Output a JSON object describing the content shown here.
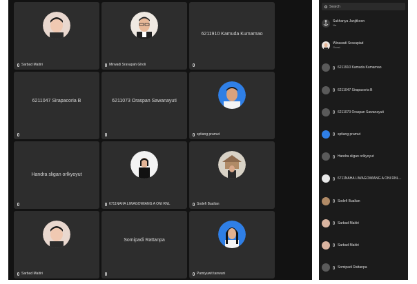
{
  "tiles": [
    {
      "caption": "Sarbad Maitiri"
    },
    {
      "caption": "Mirwadi Sravapah Gholi"
    },
    {
      "center": "6211910 Kamuda Kumarnao",
      "caption": ""
    },
    {
      "center": "6211047 Sirapacoria B",
      "caption": ""
    },
    {
      "center": "6211073 Oraspan Sawanayuti",
      "caption": ""
    },
    {
      "caption": "sptiang pramut"
    },
    {
      "center": "Handra sligan orlkyoyut",
      "caption": ""
    },
    {
      "caption": "6711NAHA LIWAGOWIANG A ONI RNL"
    },
    {
      "caption": "Sodefi Bualtan"
    },
    {
      "caption": "Sarbad Maitiri"
    },
    {
      "center": "Somipadi Rattanpa",
      "caption": ""
    },
    {
      "caption": "Pamiyuwit tanwuni"
    }
  ],
  "panel": {
    "search_placeholder": "Search",
    "participants": [
      {
        "name": "Sukhanya Janjitkoon",
        "sub": "Na"
      },
      {
        "name": "Wiruwadi Sravapiad",
        "sub": "Guest"
      },
      {
        "name": "6211910 Kamuda Kumarnao"
      },
      {
        "name": "6211047 Sirapacoria B"
      },
      {
        "name": "6211073 Oraspan Sawanayuti"
      },
      {
        "name": "sptiang pramut"
      },
      {
        "name": "Handra sligan orlkyoyut"
      },
      {
        "name": "6711NAHA LIWAGOWIANG A ONI RNL..."
      },
      {
        "name": "Sodefi Bualtan"
      },
      {
        "name": "Sarbad Maitiri"
      },
      {
        "name": "Sarbad Maitiri"
      },
      {
        "name": "Somipadi Rattanpa"
      }
    ]
  },
  "colors": {
    "stage_bg": "#121212",
    "tile_bg": "#2d2d2d",
    "panel_bg": "#1b1b1b",
    "accent_blue": "#2f7fe6"
  }
}
